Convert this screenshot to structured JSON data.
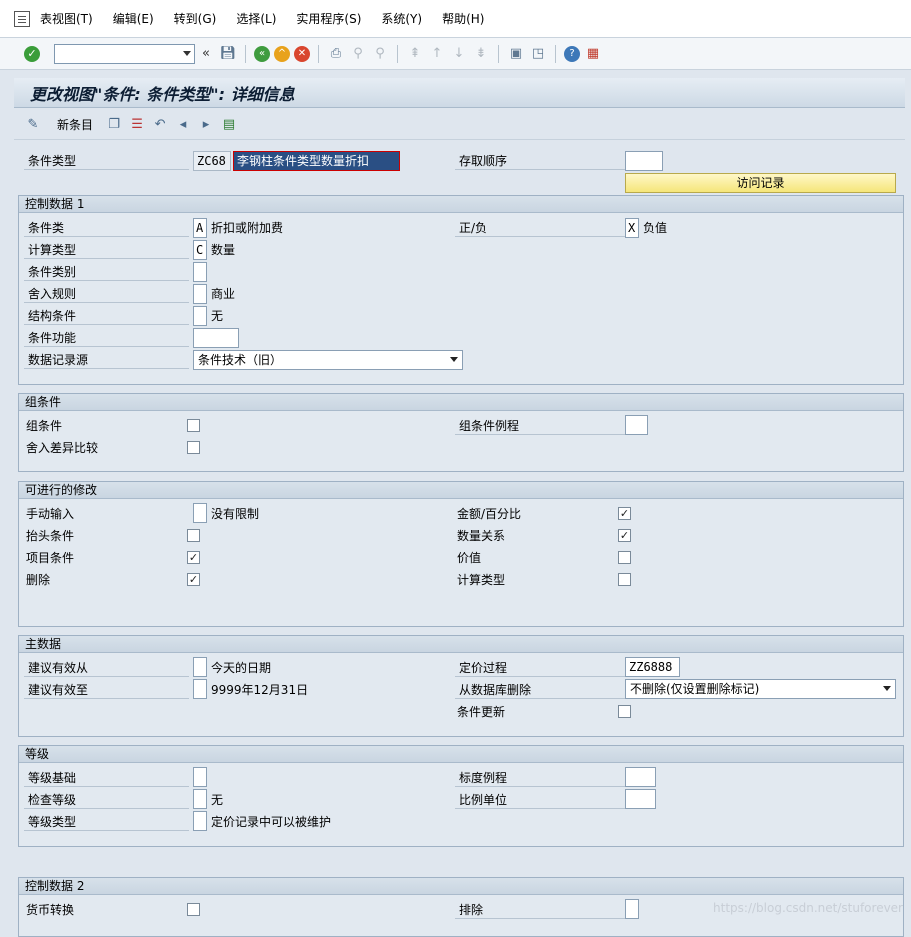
{
  "menu": [
    "表视图(T)",
    "编辑(E)",
    "转到(G)",
    "选择(L)",
    "实用程序(S)",
    "系统(Y)",
    "帮助(H)"
  ],
  "title": "更改视图\"条件: 条件类型\": 详细信息",
  "apptoolbar": {
    "new_entry": "新条目"
  },
  "header": {
    "cond_type_label": "条件类型",
    "cond_type_code": "ZC68",
    "cond_type_desc": "李钢柱条件类型数量折扣",
    "access_seq_label": "存取顺序",
    "access_seq_value": "",
    "access_btn": "访问记录"
  },
  "control1": {
    "title": "控制数据 1",
    "cond_class_label": "条件类",
    "cond_class_code": "A",
    "cond_class_text": "折扣或附加费",
    "plus_minus_label": "正/负",
    "plus_minus_code": "X",
    "plus_minus_text": "负值",
    "calc_type_label": "计算类型",
    "calc_type_code": "C",
    "calc_type_text": "数量",
    "cond_category_label": "条件类别",
    "rounding_label": "舍入规则",
    "rounding_text": "商业",
    "struct_cond_label": "结构条件",
    "struct_cond_text": "无",
    "cond_func_label": "条件功能",
    "data_source_label": "数据记录源",
    "data_source_value": "条件技术（旧）"
  },
  "groupcond": {
    "title": "组条件",
    "group_cond_label": "组条件",
    "rounding_diff_label": "舍入差异比较",
    "group_routine_label": "组条件例程"
  },
  "changes": {
    "title": "可进行的修改",
    "manual_label": "手动输入",
    "manual_text": "没有限制",
    "header_cond_label": "抬头条件",
    "item_cond_label": "项目条件",
    "delete_label": "删除",
    "amount_pct_label": "金额/百分比",
    "qty_rel_label": "数量关系",
    "value_label": "价值",
    "calc_type_label": "计算类型",
    "checks": {
      "header": false,
      "item": true,
      "delete": true,
      "amount": true,
      "qty": true,
      "value": false,
      "calc": false
    }
  },
  "master": {
    "title": "主数据",
    "valid_from_label": "建议有效从",
    "valid_from_text": "今天的日期",
    "valid_to_label": "建议有效至",
    "valid_to_text": "9999年12月31日",
    "pricing_proc_label": "定价过程",
    "pricing_proc_value": "ZZ6888",
    "db_delete_label": "从数据库删除",
    "db_delete_value": "不删除(仅设置删除标记)",
    "cond_update_label": "条件更新"
  },
  "scales": {
    "title": "等级",
    "scale_base_label": "等级基础",
    "check_scale_label": "检查等级",
    "check_scale_text": "无",
    "scale_type_label": "等级类型",
    "scale_type_text": "定价记录中可以被维护",
    "scale_routine_label": "标度例程",
    "scale_unit_label": "比例单位"
  },
  "control2": {
    "title": "控制数据 2",
    "currency_conv_label": "货币转换",
    "exclusion_label": "排除"
  },
  "watermark": "https://blog.csdn.net/stuforever"
}
